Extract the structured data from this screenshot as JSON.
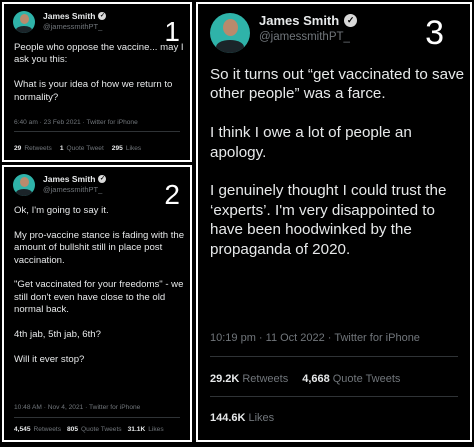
{
  "tweets": [
    {
      "number": "1",
      "author": {
        "name": "James Smith",
        "handle": "@jamessmithPT_"
      },
      "text": "People who oppose the vaccine... may I ask you this:\n\nWhat is your idea of how we return to normality?",
      "meta": "6:40 am · 23 Feb 2021 · Twitter for iPhone",
      "stats": [
        {
          "value": "29",
          "label": "Retweets"
        },
        {
          "value": "1",
          "label": "Quote Tweet"
        },
        {
          "value": "295",
          "label": "Likes"
        }
      ]
    },
    {
      "number": "2",
      "author": {
        "name": "James Smith",
        "handle": "@jamessmithPT_"
      },
      "text": "Ok, I'm going to say it.\n\nMy pro-vaccine stance is fading with the amount of bullshit still in place post vaccination.\n\n\"Get vaccinated for your freedoms\" - we still don't even have close to the old normal back.\n\n4th jab, 5th jab, 6th?\n\nWill it ever stop?",
      "meta": "10:48 AM · Nov 4, 2021 · Twitter for iPhone",
      "stats": [
        {
          "value": "4,545",
          "label": "Retweets"
        },
        {
          "value": "805",
          "label": "Quote Tweets"
        },
        {
          "value": "31.1K",
          "label": "Likes"
        }
      ]
    },
    {
      "number": "3",
      "author": {
        "name": "James Smith",
        "handle": "@jamessmithPT_"
      },
      "text": "So it turns out “get vaccinated to save other people” was a farce.\n\nI think I owe a lot of people an apology.\n\nI genuinely thought I could trust the ‘experts’. I'm very disappointed to have been hoodwinked by the propaganda of 2020.",
      "meta": "10:19 pm · 11 Oct 2022 · Twitter for iPhone",
      "stats": [
        {
          "value": "29.2K",
          "label": "Retweets"
        },
        {
          "value": "4,668",
          "label": "Quote Tweets"
        }
      ],
      "stats_likes": {
        "value": "144.6K",
        "label": "Likes"
      }
    }
  ],
  "icons": {
    "verified": "verified-badge-icon",
    "avatar": "profile-avatar"
  },
  "colors": {
    "background": "#000000",
    "panel_border": "#ffffff",
    "avatar_bg": "#2fb3a9",
    "muted_text": "#71767b"
  }
}
